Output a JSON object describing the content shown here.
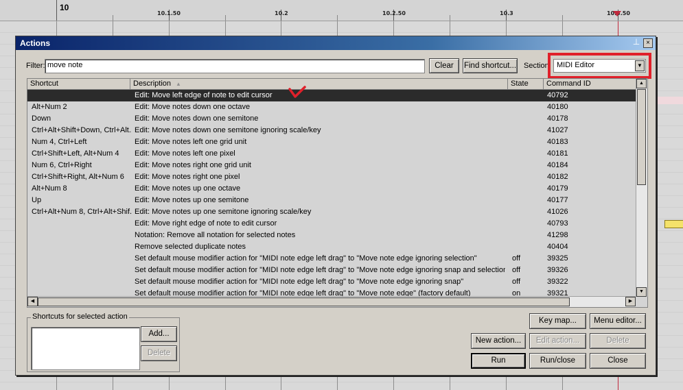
{
  "ruler": {
    "bar_label": "10",
    "labels": [
      "10.1.50",
      "10.2",
      "10.2.50",
      "10.3",
      "10.3.50"
    ]
  },
  "dialog": {
    "title": "Actions",
    "pin_glyph": "⊥",
    "close_glyph": "×",
    "filter_label": "Filter:",
    "filter_value": "move note",
    "clear_label": "Clear",
    "find_shortcut_label": "Find shortcut...",
    "section_label": "Section:",
    "section_value": "MIDI Editor",
    "columns": {
      "shortcut": "Shortcut",
      "description": "Description",
      "state": "State",
      "command_id": "Command ID"
    },
    "rows": [
      {
        "shortcut": "",
        "description": "Edit: Move left edge of note to edit cursor",
        "state": "",
        "cmd": "40792",
        "selected": true
      },
      {
        "shortcut": "Alt+Num 2",
        "description": "Edit: Move notes down one octave",
        "state": "",
        "cmd": "40180"
      },
      {
        "shortcut": "Down",
        "description": "Edit: Move notes down one semitone",
        "state": "",
        "cmd": "40178"
      },
      {
        "shortcut": "Ctrl+Alt+Shift+Down, Ctrl+Alt...",
        "description": "Edit: Move notes down one semitone ignoring scale/key",
        "state": "",
        "cmd": "41027"
      },
      {
        "shortcut": "Num 4, Ctrl+Left",
        "description": "Edit: Move notes left one grid unit",
        "state": "",
        "cmd": "40183"
      },
      {
        "shortcut": "Ctrl+Shift+Left, Alt+Num 4",
        "description": "Edit: Move notes left one pixel",
        "state": "",
        "cmd": "40181"
      },
      {
        "shortcut": "Num 6, Ctrl+Right",
        "description": "Edit: Move notes right one grid unit",
        "state": "",
        "cmd": "40184"
      },
      {
        "shortcut": "Ctrl+Shift+Right, Alt+Num 6",
        "description": "Edit: Move notes right one pixel",
        "state": "",
        "cmd": "40182"
      },
      {
        "shortcut": "Alt+Num 8",
        "description": "Edit: Move notes up one octave",
        "state": "",
        "cmd": "40179"
      },
      {
        "shortcut": "Up",
        "description": "Edit: Move notes up one semitone",
        "state": "",
        "cmd": "40177"
      },
      {
        "shortcut": "Ctrl+Alt+Num 8, Ctrl+Alt+Shif...",
        "description": "Edit: Move notes up one semitone ignoring scale/key",
        "state": "",
        "cmd": "41026"
      },
      {
        "shortcut": "",
        "description": "Edit: Move right edge of note to edit cursor",
        "state": "",
        "cmd": "40793"
      },
      {
        "shortcut": "",
        "description": "Notation: Remove all notation for selected notes",
        "state": "",
        "cmd": "41298"
      },
      {
        "shortcut": "",
        "description": "Remove selected duplicate notes",
        "state": "",
        "cmd": "40404"
      },
      {
        "shortcut": "",
        "description": "Set default mouse modifier action for \"MIDI note edge left drag\" to \"Move note edge ignoring selection\"",
        "state": "off",
        "cmd": "39325"
      },
      {
        "shortcut": "",
        "description": "Set default mouse modifier action for \"MIDI note edge left drag\" to \"Move note edge ignoring snap and selection\"",
        "state": "off",
        "cmd": "39326"
      },
      {
        "shortcut": "",
        "description": "Set default mouse modifier action for \"MIDI note edge left drag\" to \"Move note edge ignoring snap\"",
        "state": "off",
        "cmd": "39322"
      },
      {
        "shortcut": "",
        "description": "Set default mouse modifier action for \"MIDI note edge left drag\" to \"Move note edge\" (factory default)",
        "state": "on",
        "cmd": "39321"
      }
    ],
    "shortcuts_group_label": "Shortcuts for selected action",
    "add_label": "Add...",
    "delete_shortcut_label": "Delete",
    "key_map_label": "Key map...",
    "menu_editor_label": "Menu editor...",
    "new_action_label": "New action...",
    "edit_action_label": "Edit action...",
    "delete_action_label": "Delete",
    "run_label": "Run",
    "run_close_label": "Run/close",
    "close_label": "Close"
  },
  "colors": {
    "title_bar": "#0a246a",
    "selection": "#2b2b2b",
    "highlight_box": "#e0202a",
    "annotation_check": "#e0202a"
  }
}
